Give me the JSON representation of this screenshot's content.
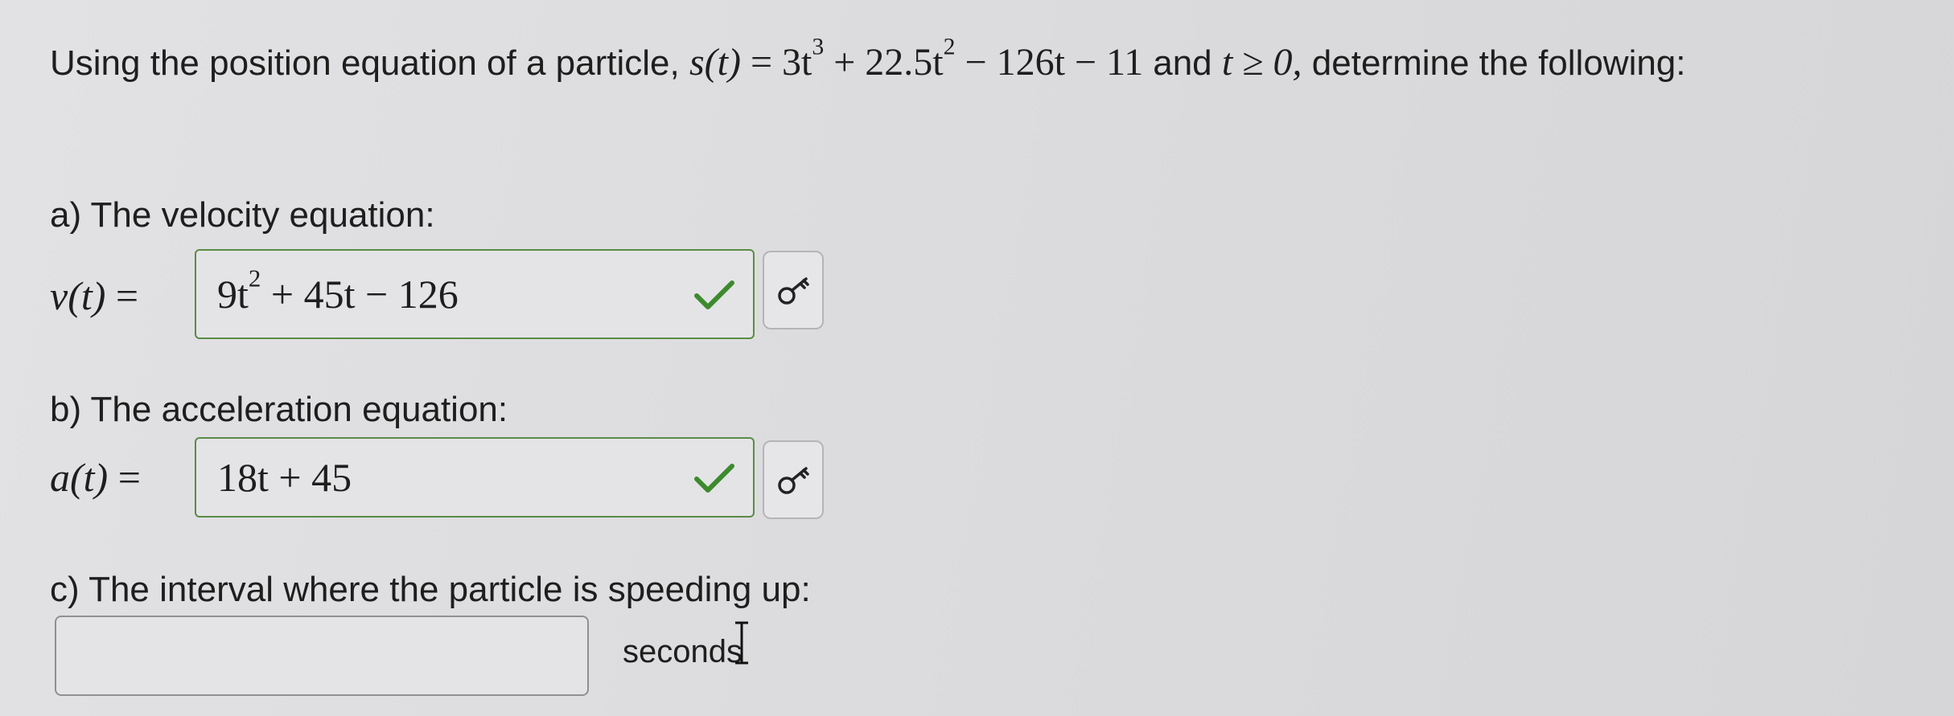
{
  "question": {
    "intro_text": "Using the position equation of a particle,",
    "equation_lhs": "s(t)",
    "equals": "=",
    "equation_rhs_part1": "3t",
    "equation_rhs_exp1": "3",
    "equation_rhs_part2": " + 22.5t",
    "equation_rhs_exp2": "2",
    "equation_rhs_part3": " − 126t − 11",
    "and_text": "and",
    "condition": "t ≥ 0,",
    "outro_text": "determine the following:"
  },
  "part_a": {
    "label": "a) The velocity equation:",
    "lhs": "v(t)",
    "equals": "=",
    "answer_part1": "9t",
    "answer_exp": "2",
    "answer_part2": " + 45t − 126",
    "status": "correct",
    "status_color": "#3d8a2e",
    "key_icon": "key-icon"
  },
  "part_b": {
    "label": "b) The acceleration equation:",
    "lhs": "a(t)",
    "equals": "=",
    "answer": "18t + 45",
    "status": "correct",
    "status_color": "#3d8a2e",
    "key_icon": "key-icon"
  },
  "part_c": {
    "label": "c) The interval where the particle is speeding up:",
    "input_value": "",
    "unit": "seconds"
  }
}
